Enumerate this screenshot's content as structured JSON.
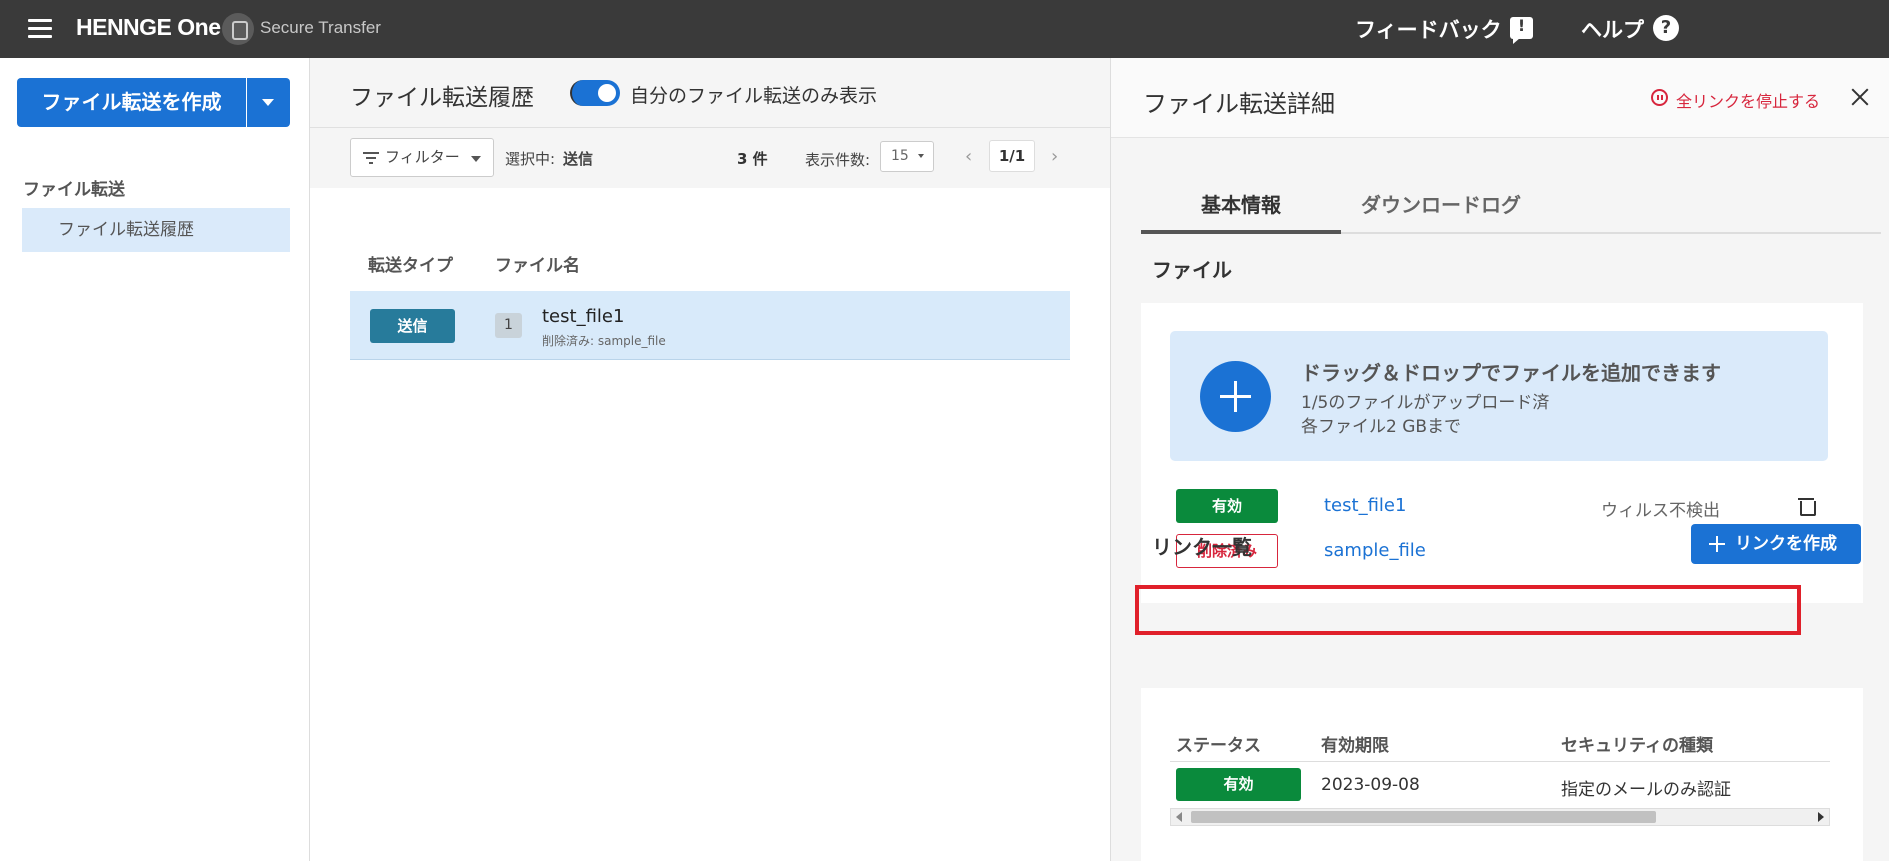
{
  "topbar": {
    "brand": "HENNGE One",
    "product": "Secure Transfer",
    "feedback": "フィードバック",
    "help": "ヘルプ",
    "help_glyph": "?"
  },
  "sidebar": {
    "create_button": "ファイル転送を作成",
    "section": "ファイル転送",
    "items": [
      {
        "label": "ファイル転送履歴"
      }
    ]
  },
  "history": {
    "title": "ファイル転送履歴",
    "toggle_label": "自分のファイル転送のみ表示",
    "filter": "フィルター",
    "selected_label": "選択中:",
    "selected_value": "送信",
    "count": "3 件",
    "per_page_label": "表示件数:",
    "per_page": "15",
    "prev": "‹",
    "page": "1/1",
    "next": "›",
    "columns": [
      "転送タイプ",
      "ファイル名"
    ],
    "rows": [
      {
        "type": "送信",
        "file_count": "1",
        "filename": "test_file1",
        "sub": "削除済み: sample_file"
      }
    ]
  },
  "detail": {
    "title": "ファイル転送詳細",
    "stop_all": "全リンクを停止する",
    "tabs": [
      "基本情報",
      "ダウンロードログ"
    ],
    "files_section": "ファイル",
    "drop_title": "ドラッグ＆ドロップでファイルを追加できます",
    "drop_sub1": "1/5のファイルがアップロード済",
    "drop_sub2": "各ファイル2 GBまで",
    "files": [
      {
        "status": "有効",
        "name": "test_file1",
        "scan": "ウィルス不検出"
      },
      {
        "status": "削除済み",
        "name": "sample_file",
        "scan": ""
      }
    ],
    "links_section": "リンク一覧",
    "create_link": "リンクを作成",
    "link_columns": [
      "ステータス",
      "有効期限",
      "セキュリティの種類"
    ],
    "links": [
      {
        "status": "有効",
        "expiry": "2023-09-08",
        "security": "指定のメールのみ認証"
      }
    ],
    "colors": {
      "accent": "#1b72d4",
      "valid": "#0a8a3c",
      "danger": "#d7263d",
      "highlight": "#e0202a"
    }
  }
}
